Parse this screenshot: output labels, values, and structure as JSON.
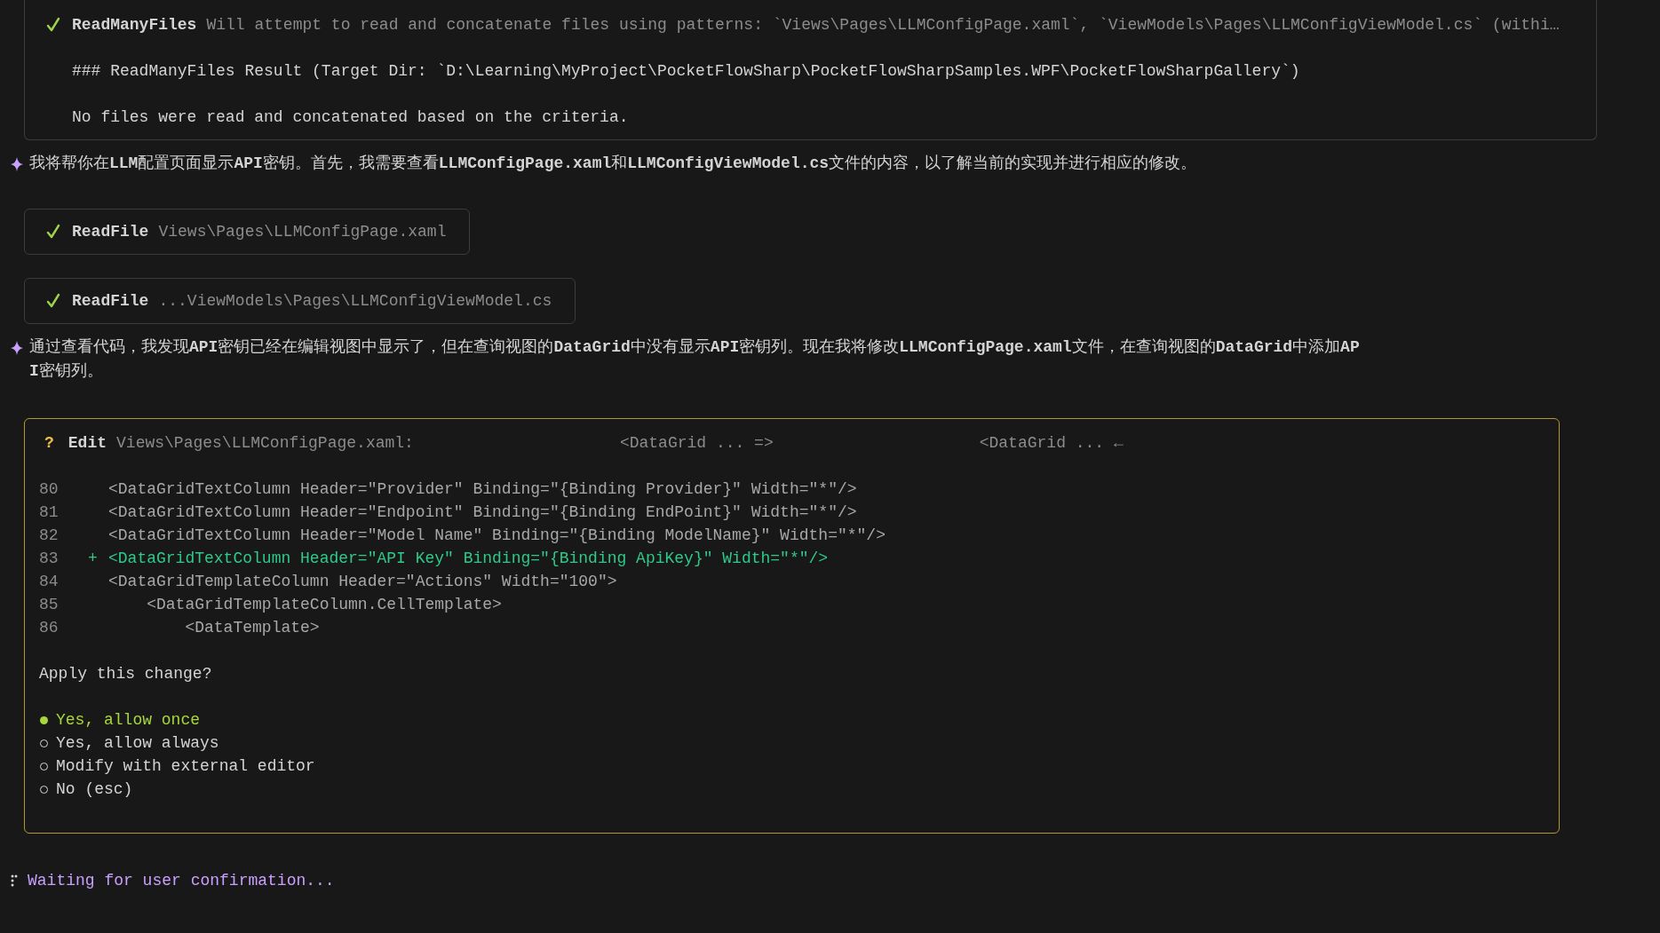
{
  "tool_result": {
    "tool": "ReadManyFiles",
    "description": "Will attempt to read and concatenate files using patterns: `Views\\Pages\\LLMConfigPage.xaml`, `ViewModels\\Pages\\LLMConfigViewModel.cs` (withi…",
    "result_heading": "### ReadManyFiles Result (Target Dir: `D:\\Learning\\MyProject\\PocketFlowSharp\\PocketFlowSharpSamples.WPF\\PocketFlowSharpGallery`)",
    "result_text": "No files were read and concatenated based on the criteria."
  },
  "message_1": {
    "lines": [
      "我将帮你在**LLM**配置页面显示**API**密钥。首先，我需要查看**LLMConfigPage.xaml**和**LLMConfigViewModel.cs**文件的内容，以了解当前的实现并进行相应的修改。"
    ]
  },
  "read_files": [
    {
      "tool": "ReadFile",
      "path": "Views\\Pages\\LLMConfigPage.xaml"
    },
    {
      "tool": "ReadFile",
      "path": "...ViewModels\\Pages\\LLMConfigViewModel.cs"
    }
  ],
  "message_2": {
    "lines": [
      "通过查看代码，我发现**API**密钥已经在编辑视图中显示了，但在查询视图的**DataGrid**中没有显示**API**密钥列。现在我将修改**LLMConfigPage.xaml**文件，在查询视图的**DataGrid**中添加**AP**",
      "**I**密钥列。"
    ]
  },
  "edit_prompt": {
    "marker": "?",
    "action": "Edit",
    "path": "Views\\Pages\\LLMConfigPage.xaml:",
    "old_snippet": "<DataGrid ... =>",
    "new_snippet": "<DataGrid ... ←",
    "code_lines": [
      {
        "number": "80",
        "kind": "context",
        "text": "<DataGridTextColumn Header=\"Provider\" Binding=\"{Binding Provider}\" Width=\"*\"/>"
      },
      {
        "number": "81",
        "kind": "context",
        "text": "<DataGridTextColumn Header=\"Endpoint\" Binding=\"{Binding EndPoint}\" Width=\"*\"/>"
      },
      {
        "number": "82",
        "kind": "context",
        "text": "<DataGridTextColumn Header=\"Model Name\" Binding=\"{Binding ModelName}\" Width=\"*\"/>"
      },
      {
        "number": "83",
        "kind": "added",
        "marker": "+",
        "text": "<DataGridTextColumn Header=\"API Key\" Binding=\"{Binding ApiKey}\" Width=\"*\"/>"
      },
      {
        "number": "84",
        "kind": "context",
        "text": "<DataGridTemplateColumn Header=\"Actions\" Width=\"100\">"
      },
      {
        "number": "85",
        "kind": "context",
        "text": "    <DataGridTemplateColumn.CellTemplate>"
      },
      {
        "number": "86",
        "kind": "context",
        "text": "        <DataTemplate>"
      }
    ],
    "question": "Apply this change?",
    "options": [
      {
        "label": "Yes, allow once",
        "selected": true
      },
      {
        "label": "Yes, allow always",
        "selected": false
      },
      {
        "label": "Modify with external editor",
        "selected": false
      },
      {
        "label": "No (esc)",
        "selected": false
      }
    ]
  },
  "status": {
    "text": "Waiting for user confirmation..."
  }
}
